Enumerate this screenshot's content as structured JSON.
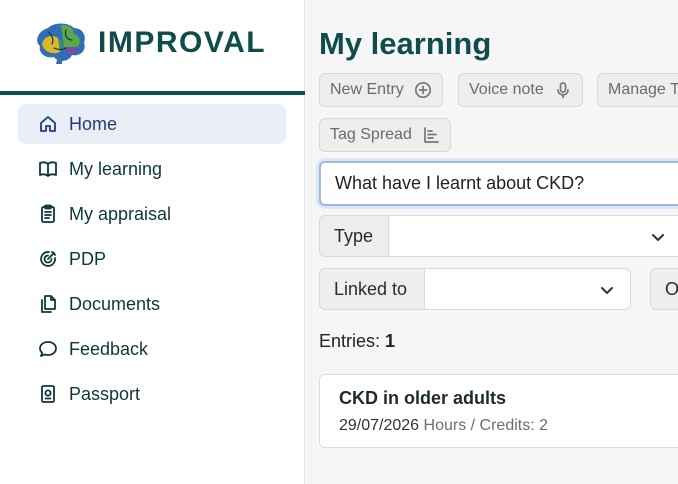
{
  "brand": {
    "name": "IMPROVAL"
  },
  "sidebar": {
    "items": [
      {
        "label": "Home",
        "icon": "home-icon",
        "active": true
      },
      {
        "label": "My learning",
        "icon": "book-icon"
      },
      {
        "label": "My appraisal",
        "icon": "clipboard-icon"
      },
      {
        "label": "PDP",
        "icon": "target-icon"
      },
      {
        "label": "Documents",
        "icon": "documents-icon"
      },
      {
        "label": "Feedback",
        "icon": "chat-bubble-icon"
      },
      {
        "label": "Passport",
        "icon": "passport-icon"
      }
    ]
  },
  "main": {
    "title": "My learning",
    "toolbar": {
      "new_entry": "New Entry",
      "voice_note": "Voice note",
      "manage_tags": "Manage T",
      "tag_spread": "Tag Spread"
    },
    "search": {
      "value": "What have I learnt about CKD?"
    },
    "filters": {
      "type_label": "Type",
      "type_value": "",
      "linked_label": "Linked to",
      "linked_value": "",
      "other_label": "O"
    },
    "entries": {
      "label": "Entries:",
      "count": "1"
    },
    "cards": [
      {
        "title": "CKD in older adults",
        "date": "29/07/2026",
        "meta": "Hours / Credits: 2"
      }
    ]
  },
  "colors": {
    "brand": "#0f4c4c",
    "active_bg": "#e9eef6",
    "active_text": "#243b77",
    "focus": "#9db6e2"
  }
}
